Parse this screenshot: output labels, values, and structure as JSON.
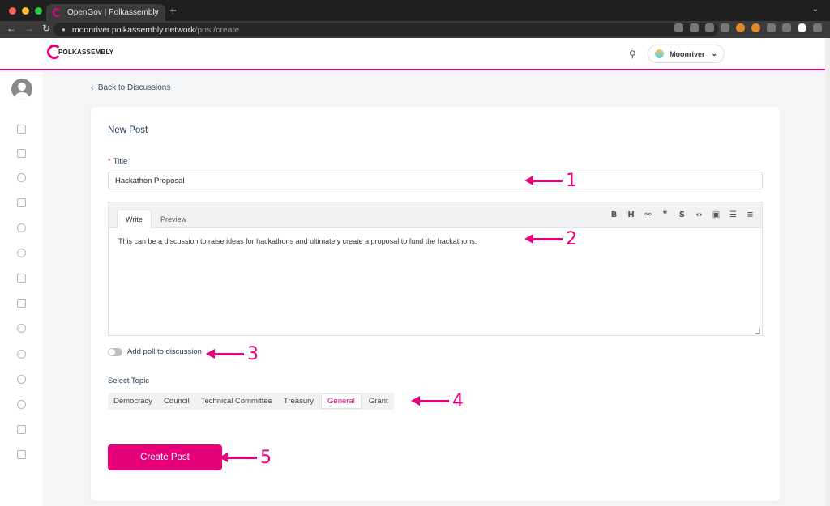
{
  "browser": {
    "tab_title": "OpenGov | Polkassembly",
    "url_host": "moonriver.polkassembly.network",
    "url_path": "/post/create",
    "close_symbol": "×",
    "new_tab_symbol": "+"
  },
  "header": {
    "logo_text": "POLKASSEMBLY",
    "network_name": "Moonriver"
  },
  "main": {
    "back_link": "Back to Discussions",
    "card_title": "New Post",
    "title_label": "Title",
    "title_required": "*",
    "title_value": "Hackathon Proposal",
    "editor": {
      "write_tab": "Write",
      "preview_tab": "Preview",
      "body": "This can be a discussion to raise ideas for hackathons and ultimately create a proposal to fund the hackathons."
    },
    "poll_label": "Add poll to discussion",
    "topic_label": "Select Topic",
    "topics": [
      "Democracy",
      "Council",
      "Technical Committee",
      "Treasury",
      "General",
      "Grant"
    ],
    "selected_topic": "General",
    "create_button": "Create Post"
  },
  "annotations": [
    "1",
    "2",
    "3",
    "4",
    "5"
  ],
  "colors": {
    "accent": "#e6007a",
    "text_dark": "#243a57",
    "background": "#f4f5f7"
  }
}
